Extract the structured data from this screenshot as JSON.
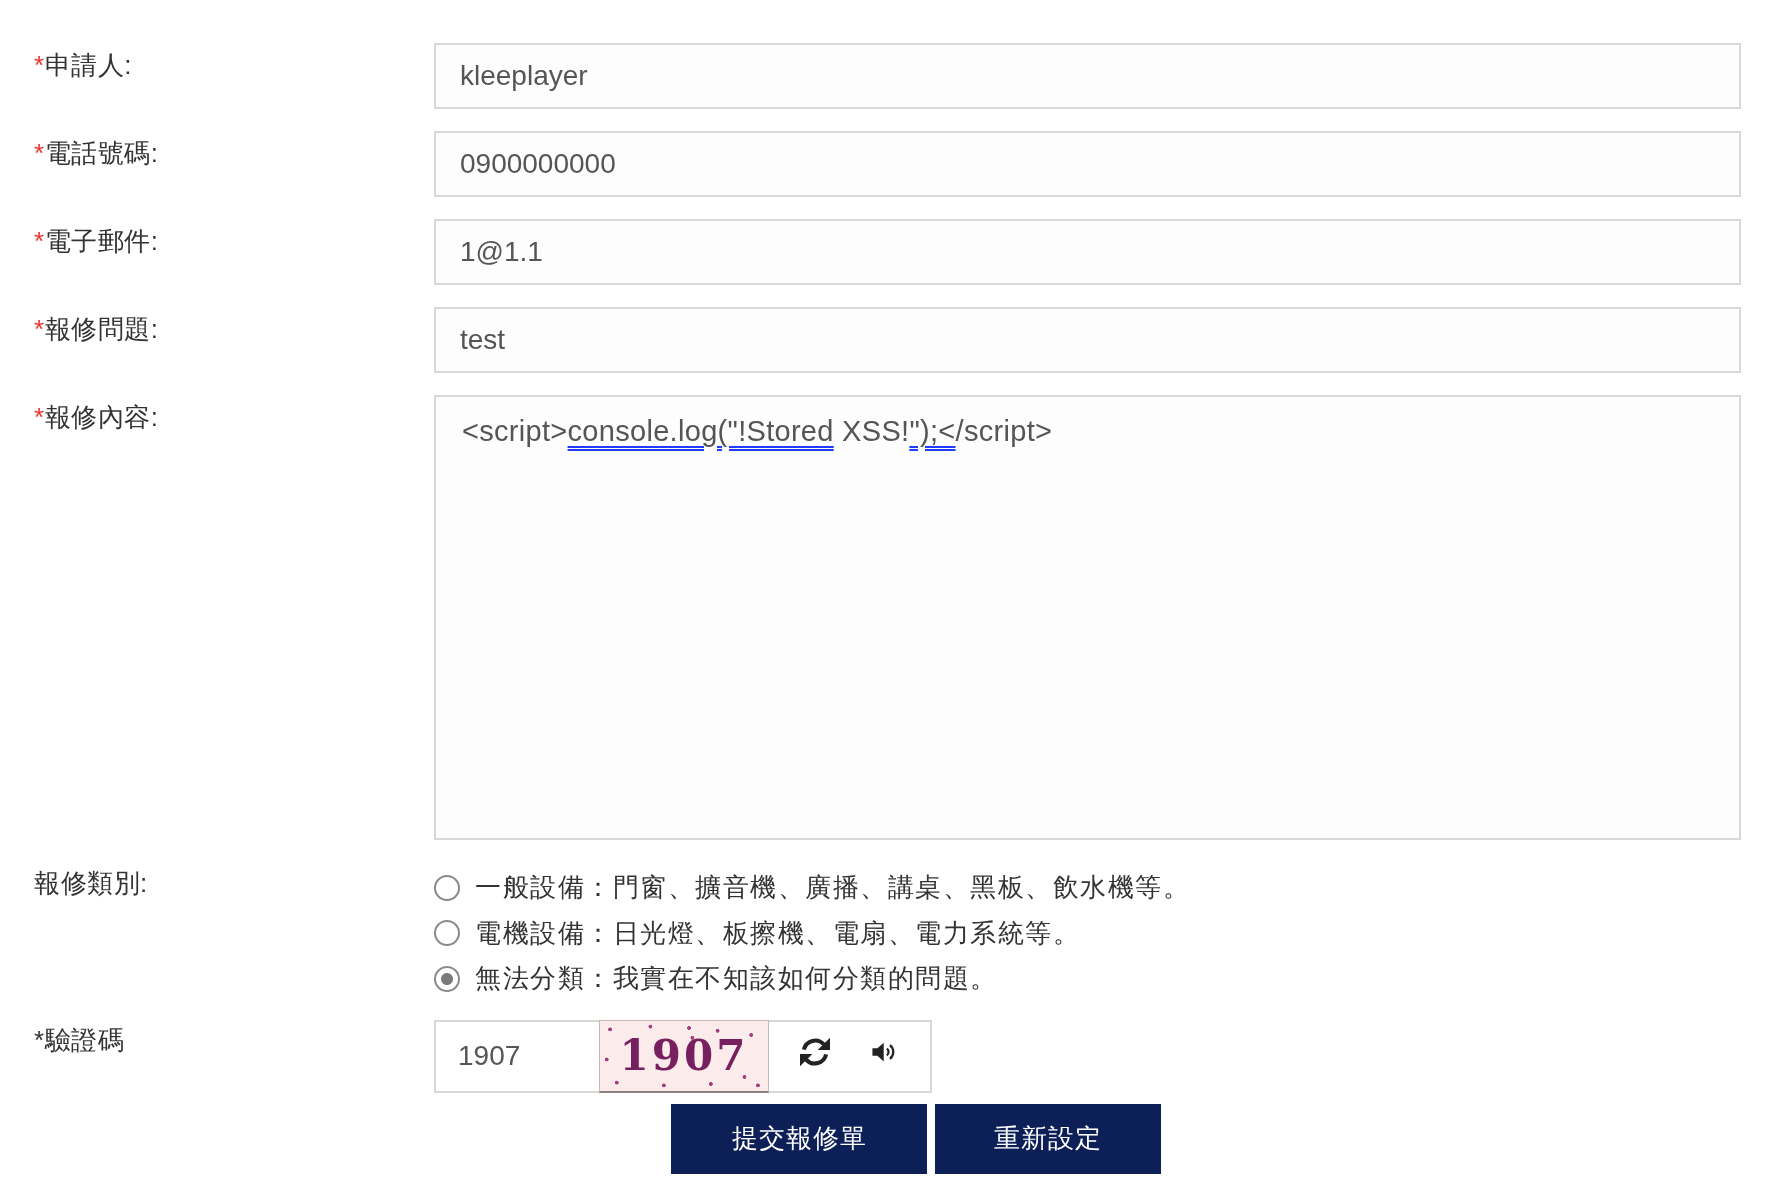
{
  "fields": [
    {
      "kind": "input",
      "required_mark": "*",
      "label": "申請人:",
      "value": "kleeplayer"
    },
    {
      "kind": "input",
      "required_mark": "*",
      "label": "電話號碼:",
      "value": "0900000000"
    },
    {
      "kind": "input",
      "required_mark": "*",
      "label": "電子郵件:",
      "value": "1@1.1"
    },
    {
      "kind": "input",
      "required_mark": "*",
      "label": "報修問題:",
      "value": "test"
    },
    {
      "kind": "textarea",
      "required_mark": "*",
      "label": "報修內容:",
      "segments": [
        {
          "text": "<script>",
          "flagged": false
        },
        {
          "text": "console.log(\"!Stored",
          "flagged": true
        },
        {
          "text": " XSS!",
          "flagged": false
        },
        {
          "text": "\");<",
          "flagged": true
        },
        {
          "text": "/script>",
          "flagged": false
        }
      ]
    }
  ],
  "repair_category": {
    "label": "報修類別:",
    "options": [
      {
        "label": "一般設備：門窗、擴音機、廣播、講桌、黑板、飲水機等。",
        "selected": false
      },
      {
        "label": "電機設備：日光燈、板擦機、電扇、電力系統等。",
        "selected": false
      },
      {
        "label": "無法分類：我實在不知該如何分類的問題。",
        "selected": true
      }
    ]
  },
  "captcha": {
    "label": "*驗證碼",
    "value": "1907",
    "image_text": "1907"
  },
  "buttons": [
    {
      "label": "提交報修單"
    },
    {
      "label": "重新設定"
    }
  ]
}
